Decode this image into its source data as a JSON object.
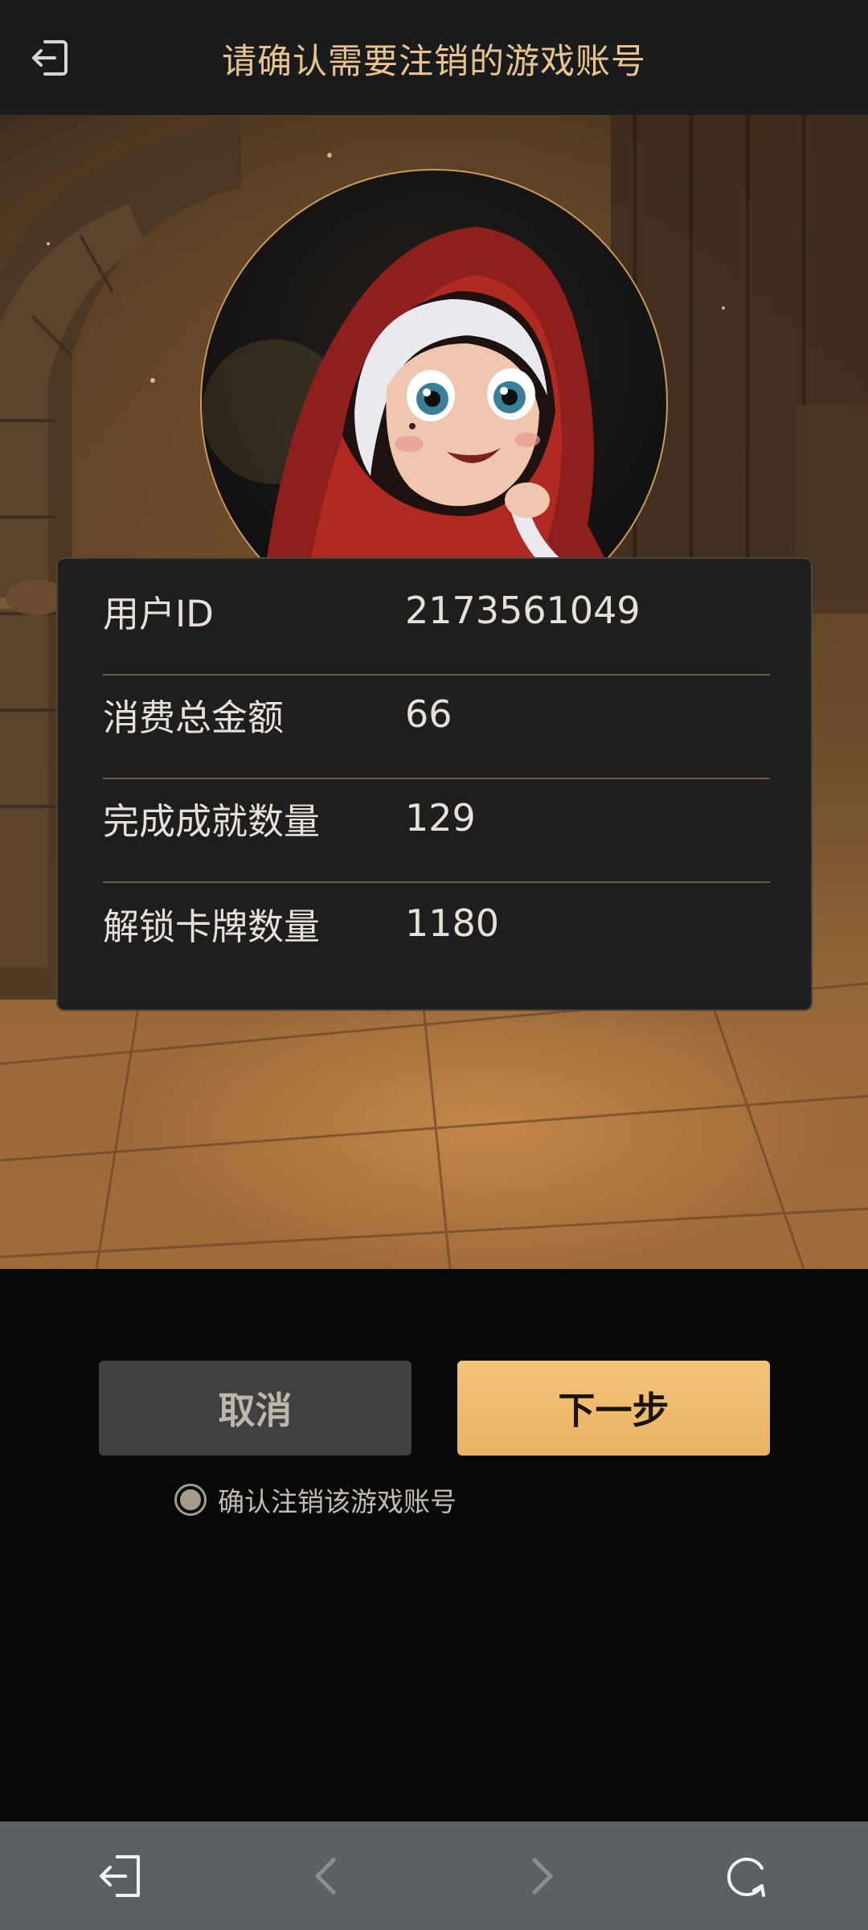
{
  "header": {
    "title": "请确认需要注销的游戏账号",
    "back_icon": "exit-arrow-icon"
  },
  "account": {
    "rows": [
      {
        "label": "用户ID",
        "value": "2173561049"
      },
      {
        "label": "消费总金额",
        "value": "66"
      },
      {
        "label": "完成成就数量",
        "value": "129"
      },
      {
        "label": "解锁卡牌数量",
        "value": "1180"
      }
    ]
  },
  "actions": {
    "cancel_label": "取消",
    "next_label": "下一步",
    "confirm_label": "确认注销该游戏账号"
  },
  "bottom_nav": {
    "items": [
      "exit-icon",
      "back-chevron-icon",
      "forward-chevron-icon",
      "refresh-icon"
    ]
  },
  "colors": {
    "accent": "#e8c48c",
    "next_button": "#f0bf74",
    "cancel_button": "#404040"
  }
}
